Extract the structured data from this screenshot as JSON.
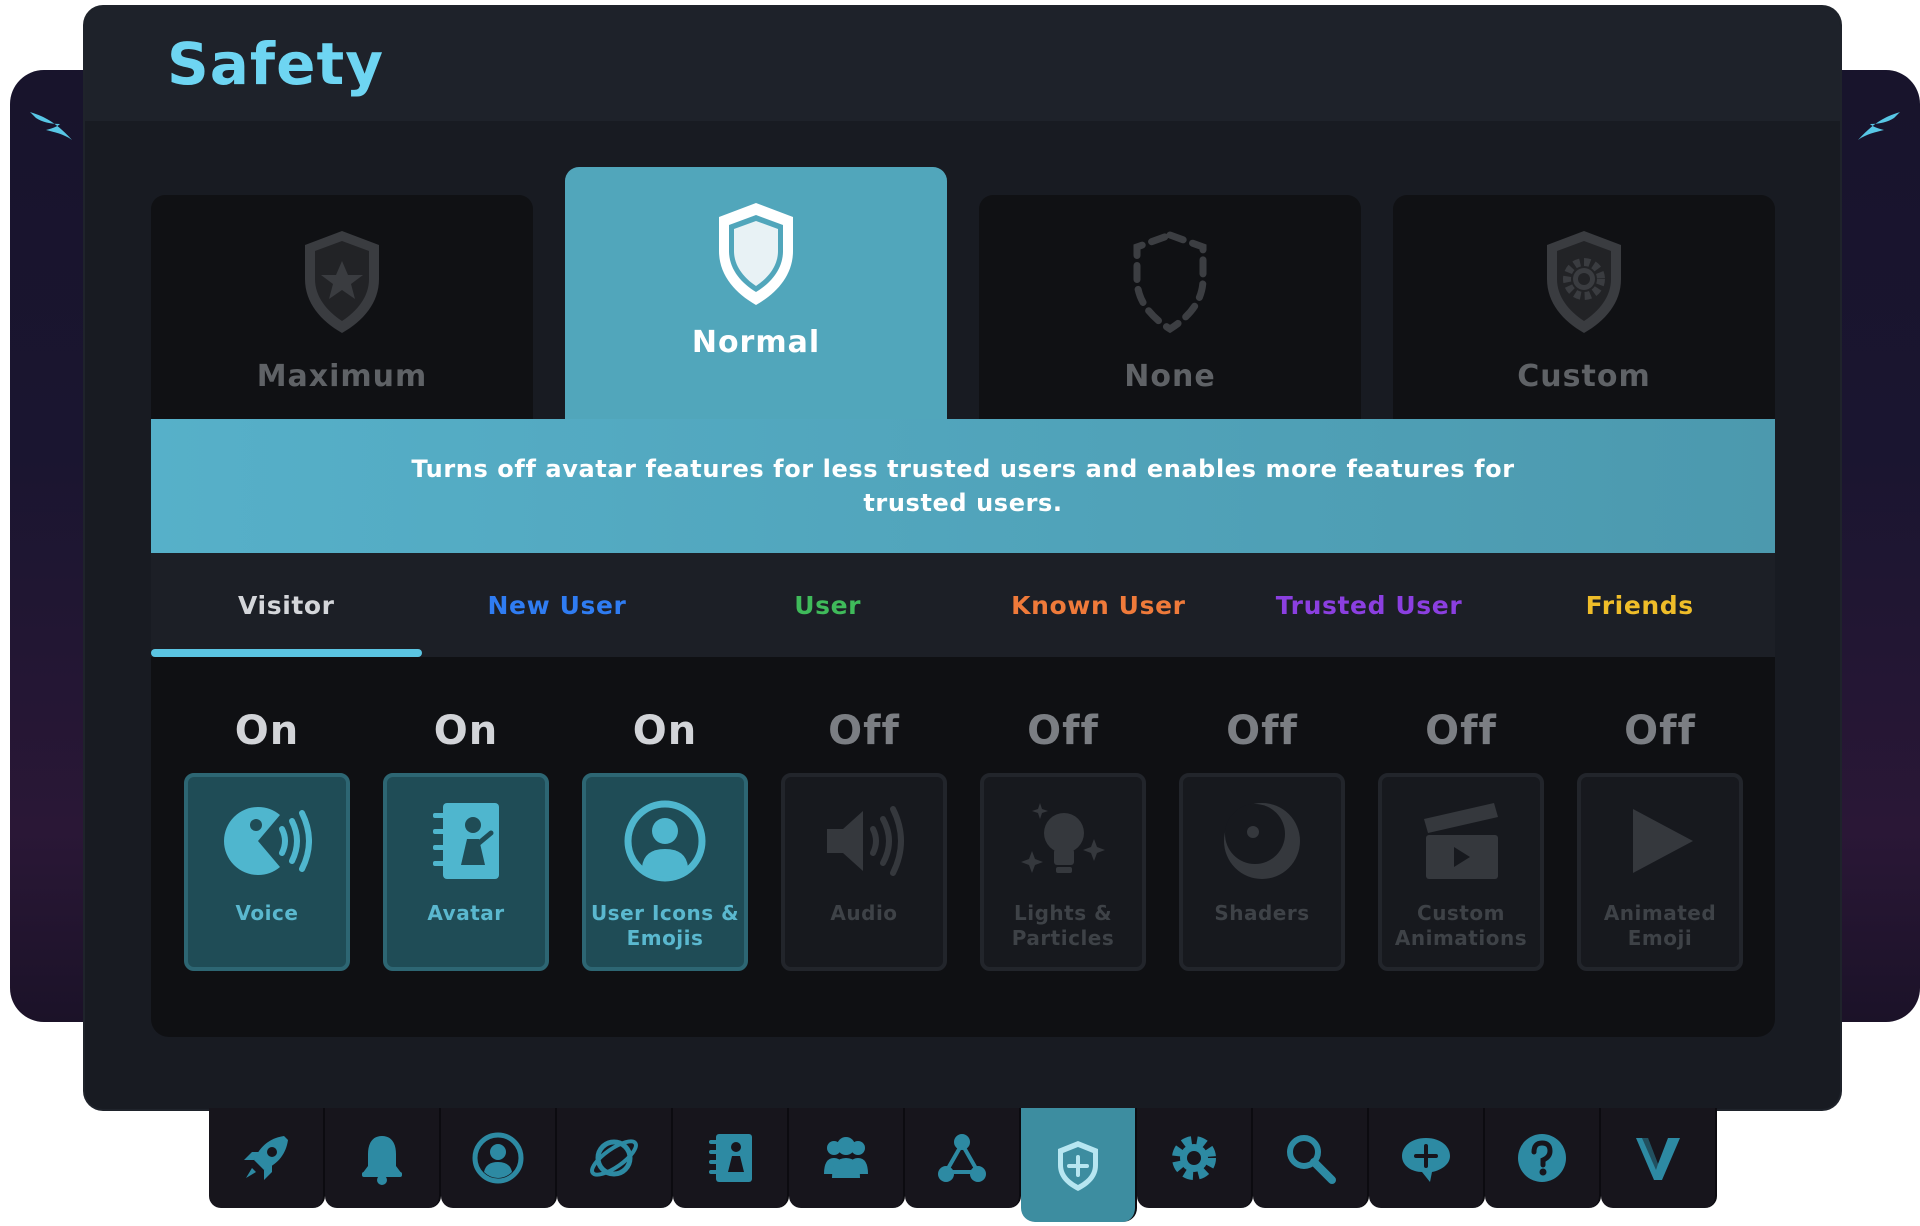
{
  "window": {
    "title": "Safety"
  },
  "colors": {
    "accent": "#6ed5f2",
    "selected_preset": "#51a6bb",
    "tab_underline": "#5bc5e2",
    "feature_on_icon": "#4fb6ce",
    "feature_off_icon": "#35383d"
  },
  "presets": [
    {
      "label": "Maximum",
      "icon": "shield-star-icon",
      "selected": false
    },
    {
      "label": "Normal",
      "icon": "shield-icon",
      "selected": true
    },
    {
      "label": "None",
      "icon": "dashed-shield-icon",
      "selected": false
    },
    {
      "label": "Custom",
      "icon": "shield-gear-icon",
      "selected": false
    }
  ],
  "description": "Turns off avatar features for less trusted users and enables more features for trusted users.",
  "trust_tabs": [
    {
      "label": "Visitor",
      "color": "#d4d6da",
      "active": true
    },
    {
      "label": "New User",
      "color": "#2f7cf2",
      "active": false
    },
    {
      "label": "User",
      "color": "#3fba5a",
      "active": false
    },
    {
      "label": "Known User",
      "color": "#ef7a3a",
      "active": false
    },
    {
      "label": "Trusted User",
      "color": "#8b3fe0",
      "active": false
    },
    {
      "label": "Friends",
      "color": "#efbd29",
      "active": false
    }
  ],
  "features": [
    {
      "state": "On",
      "label": "Voice",
      "icon": "voice-icon"
    },
    {
      "state": "On",
      "label": "Avatar",
      "icon": "avatar-book-icon"
    },
    {
      "state": "On",
      "label": "User Icons & Emojis",
      "icon": "user-circle-icon"
    },
    {
      "state": "Off",
      "label": "Audio",
      "icon": "speaker-icon"
    },
    {
      "state": "Off",
      "label": "Lights & Particles",
      "icon": "lightbulb-sparkle-icon"
    },
    {
      "state": "Off",
      "label": "Shaders",
      "icon": "moon-sphere-icon"
    },
    {
      "state": "Off",
      "label": "Custom Animations",
      "icon": "clapperboard-icon"
    },
    {
      "state": "Off",
      "label": "Animated Emoji",
      "icon": "play-icon"
    }
  ],
  "bottom_nav": [
    {
      "icon": "rocket-icon",
      "active": false
    },
    {
      "icon": "bell-icon",
      "active": false
    },
    {
      "icon": "profile-icon",
      "active": false
    },
    {
      "icon": "planet-icon",
      "active": false
    },
    {
      "icon": "avatar-book-icon",
      "active": false
    },
    {
      "icon": "people-icon",
      "active": false
    },
    {
      "icon": "network-icon",
      "active": false
    },
    {
      "icon": "shield-icon",
      "active": true
    },
    {
      "icon": "gear-icon",
      "active": false
    },
    {
      "icon": "search-icon",
      "active": false
    },
    {
      "icon": "chat-plus-icon",
      "active": false
    },
    {
      "icon": "help-icon",
      "active": false
    },
    {
      "icon": "vrchat-logo-icon",
      "active": false
    }
  ]
}
